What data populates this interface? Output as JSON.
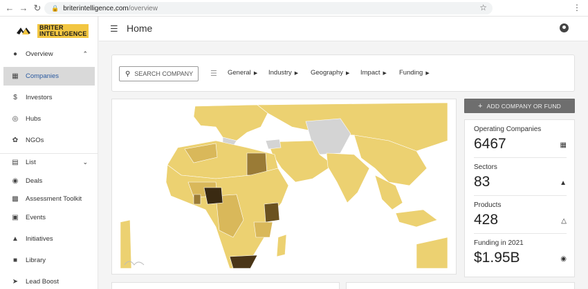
{
  "browser": {
    "url_domain": "briterintelligence.com",
    "url_path": "/overview"
  },
  "logo": {
    "line1": "BRITER",
    "line2": "INTELLIGENCE"
  },
  "sidebar": {
    "items": [
      {
        "label": "Overview",
        "icon": "globe-icon"
      },
      {
        "label": "Companies",
        "icon": "building-icon"
      },
      {
        "label": "Investors",
        "icon": "dollar-icon"
      },
      {
        "label": "Hubs",
        "icon": "hub-icon"
      },
      {
        "label": "NGOs",
        "icon": "leaf-icon"
      },
      {
        "label": "List",
        "icon": "table-icon"
      },
      {
        "label": "Deals",
        "icon": "coin-icon"
      },
      {
        "label": "Assessment Toolkit",
        "icon": "clipboard-icon"
      },
      {
        "label": "Events",
        "icon": "calendar-icon"
      },
      {
        "label": "Initiatives",
        "icon": "flame-icon"
      },
      {
        "label": "Library",
        "icon": "book-icon"
      },
      {
        "label": "Lead Boost",
        "icon": "rocket-icon"
      }
    ],
    "active": "Companies"
  },
  "header": {
    "title": "Home"
  },
  "filters": {
    "search_label": "SEARCH COMPANY",
    "items": [
      "General",
      "Industry",
      "Geography",
      "Impact",
      "Funding"
    ]
  },
  "actions": {
    "add_label": "ADD COMPANY OR FUND"
  },
  "stats": [
    {
      "label": "Operating Companies",
      "value": "6467",
      "icon": "building-icon"
    },
    {
      "label": "Sectors",
      "value": "83",
      "icon": "shapes-icon"
    },
    {
      "label": "Products",
      "value": "428",
      "icon": "shapes-outline-icon"
    },
    {
      "label": "Funding in 2021",
      "value": "$1.95B",
      "icon": "dollar-circle-icon"
    }
  ],
  "map": {
    "colors": {
      "base": "#ecd171",
      "mid": "#d9b85a",
      "dark": "#9a7b36",
      "darkest": "#3a2a12",
      "nodata": "#d4d4d4",
      "water": "#ffffff"
    }
  }
}
